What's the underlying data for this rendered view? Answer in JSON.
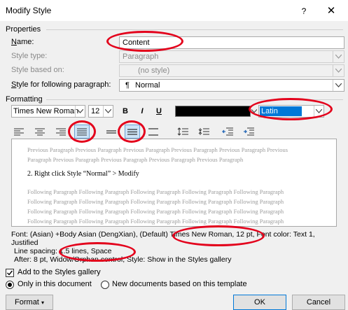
{
  "window": {
    "title": "Modify Style",
    "help_glyph": "?",
    "close_glyph": "✕"
  },
  "properties": {
    "section_label": "Properties",
    "name_label": "Name:",
    "name_value": "Content",
    "style_type_label": "Style type:",
    "style_type_value": "Paragraph",
    "based_on_label": "Style based on:",
    "based_on_value": "(no style)",
    "following_label": "Style for following paragraph:",
    "following_value": "Normal",
    "following_icon": "pilcrow-icon"
  },
  "formatting": {
    "section_label": "Formatting",
    "font_value": "Times New Roman",
    "size_value": "12",
    "bold": "B",
    "italic": "I",
    "underline": "U",
    "font_color": "#000000",
    "script_value": "Latin"
  },
  "preview": {
    "previous_1": "Previous Paragraph Previous Paragraph Previous Paragraph Previous Paragraph Previous Paragraph Previous",
    "previous_2": "Paragraph Previous Paragraph Previous Paragraph Previous Paragraph Previous Paragraph",
    "sample": "2. Right click Style “Normal” > Modify",
    "following_1": "Following Paragraph Following Paragraph Following Paragraph Following Paragraph Following Paragraph",
    "following_2": "Following Paragraph Following Paragraph Following Paragraph Following Paragraph Following Paragraph",
    "following_3": "Following Paragraph Following Paragraph Following Paragraph Following Paragraph Following Paragraph",
    "following_4": "Following Paragraph Following Paragraph Following Paragraph Following Paragraph Following Paragraph"
  },
  "description": {
    "line1": "Font: (Asian) +Body Asian (DengXian), (Default) Times New Roman, 12 pt, Font color: Text 1,",
    "line2": "Justified",
    "line3": "Line spacing:  1.5 lines, Space",
    "line4": "After:  8 pt, Widow/Orphan control, Style: Show in the Styles gallery"
  },
  "options": {
    "add_to_gallery": "Add to the Styles gallery",
    "only_this_doc": "Only in this document",
    "new_docs": "New documents based on this template"
  },
  "buttons": {
    "format": "Format",
    "ok": "OK",
    "cancel": "Cancel"
  },
  "colors": {
    "annotation_circle": "#e3001b",
    "selected_highlight": "#cce4f7",
    "latin_highlight": "#0078d7"
  }
}
